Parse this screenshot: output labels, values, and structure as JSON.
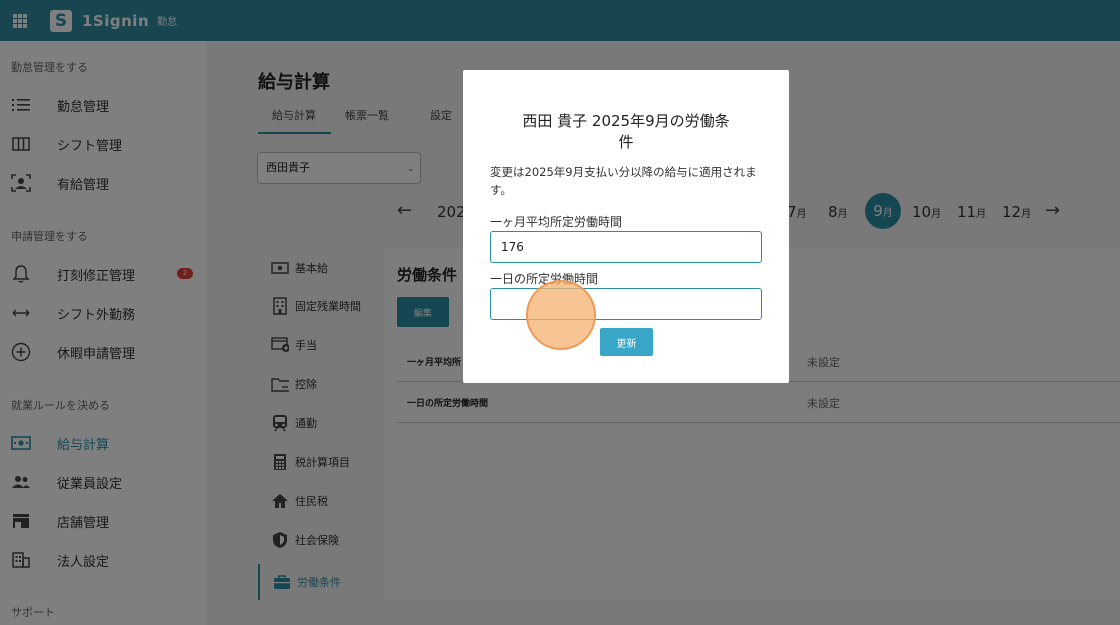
{
  "app": {
    "brand": "1Signin",
    "brand_sub": "勤怠",
    "logo_letter": "S"
  },
  "sidebar": {
    "sections": [
      {
        "title": "勤怠管理をする",
        "items": [
          {
            "label": "勤怠管理",
            "icon": "list-icon"
          },
          {
            "label": "シフト管理",
            "icon": "columns-icon"
          },
          {
            "label": "有給管理",
            "icon": "person-frame-icon"
          }
        ]
      },
      {
        "title": "申請管理をする",
        "items": [
          {
            "label": "打刻修正管理",
            "icon": "bell-icon",
            "badge": "2"
          },
          {
            "label": "シフト外勤務",
            "icon": "arrows-horizontal-icon"
          },
          {
            "label": "休暇申請管理",
            "icon": "plus-circle-icon"
          }
        ]
      },
      {
        "title": "就業ルールを決める",
        "items": [
          {
            "label": "給与計算",
            "icon": "money-icon",
            "active": true
          },
          {
            "label": "従業員設定",
            "icon": "people-icon"
          },
          {
            "label": "店舗管理",
            "icon": "store-icon"
          },
          {
            "label": "法人設定",
            "icon": "building-icon"
          }
        ]
      },
      {
        "title": "サポート",
        "items": []
      }
    ]
  },
  "main": {
    "title": "給与計算",
    "tabs": [
      "給与計算",
      "帳票一覧",
      "設定"
    ],
    "employee_select": "西田貴子",
    "months": {
      "year_partial": "202",
      "items": [
        {
          "num": "7",
          "unit": "月"
        },
        {
          "num": "8",
          "unit": "月"
        },
        {
          "num": "9",
          "unit": "月",
          "selected": true
        },
        {
          "num": "10",
          "unit": "月"
        },
        {
          "num": "11",
          "unit": "月"
        },
        {
          "num": "12",
          "unit": "月"
        }
      ],
      "prev_arrow": "←",
      "next_arrow": "→"
    },
    "subnav": [
      {
        "label": "基本給",
        "icon": "money-icon"
      },
      {
        "label": "固定残業時間",
        "icon": "building-icon"
      },
      {
        "label": "手当",
        "icon": "card-plus-icon"
      },
      {
        "label": "控除",
        "icon": "folder-icon"
      },
      {
        "label": "通勤",
        "icon": "train-icon"
      },
      {
        "label": "税計算項目",
        "icon": "calculator-icon"
      },
      {
        "label": "住民税",
        "icon": "home-icon"
      },
      {
        "label": "社会保険",
        "icon": "shield-icon"
      },
      {
        "label": "労働条件",
        "icon": "briefcase-icon",
        "active": true
      }
    ],
    "panel": {
      "title": "労働条件",
      "edit_label": "編集",
      "rows": [
        {
          "key": "一ヶ月平均所",
          "value": "未設定"
        },
        {
          "key": "一日の所定労働時間",
          "value": "未設定"
        }
      ]
    }
  },
  "modal": {
    "title_line1": "西田 貴子 2025年9月の労働条",
    "title_line2": "件",
    "note": "変更は2025年9月支払い分以降の給与に適用されます。",
    "field1_label": "一ヶ月平均所定労働時間",
    "field1_value": "176",
    "field2_label": "一日の所定労働時間",
    "field2_value": "",
    "update_label": "更新"
  },
  "colors": {
    "accent": "#2a8ea6",
    "topbar": "#2f8aa0",
    "badge": "#e23c3c"
  }
}
